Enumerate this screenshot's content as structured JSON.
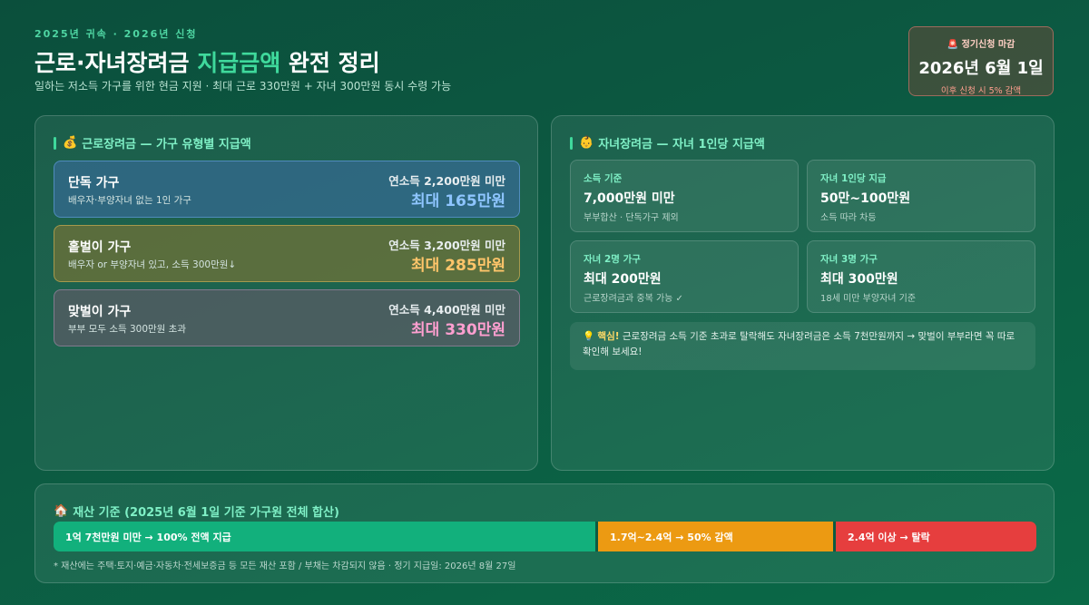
{
  "header": {
    "eyebrow": "2025년 귀속 · 2026년 신청",
    "title_pre": "근로·자녀장려금 ",
    "title_accent": "지급금액",
    "title_post": " 완전 정리",
    "subtitle": "일하는 저소득 가구를 위한 현금 지원 · 최대 근로 330만원 + 자녀 300만원 동시 수령 가능"
  },
  "deadline": {
    "label": "정기신청 마감",
    "icon": "siren-icon",
    "date": "2026년 6월 1일",
    "note": "이후 신청 시 5% 감액"
  },
  "earned_credit": {
    "heading": "근로장려금 — 가구 유형별 지급액",
    "icon": "money-bag-icon",
    "households": [
      {
        "name": "단독 가구",
        "desc": "배우자·부양자녀 없는 1인 가구",
        "limit": "연소득 2,200만원 미만",
        "amount": "최대 165만원",
        "color": "#8ec5ff"
      },
      {
        "name": "홑벌이 가구",
        "desc": "배우자 or 부양자녀 있고, 소득 300만원↓",
        "limit": "연소득 3,200만원 미만",
        "amount": "최대 285만원",
        "color": "#ffc56a"
      },
      {
        "name": "맞벌이 가구",
        "desc": "부부 모두 소득 300만원 초과",
        "limit": "연소득 4,400만원 미만",
        "amount": "최대 330만원",
        "color": "#ff9fd0"
      }
    ]
  },
  "child_credit": {
    "heading": "자녀장려금 — 자녀 1인당 지급액",
    "icon": "baby-icon",
    "cards": [
      {
        "label": "소득 기준",
        "value": "7,000만원 미만",
        "note": "부부합산 · 단독가구 제외"
      },
      {
        "label": "자녀 1인당 지급",
        "value": "50만~100만원",
        "note": "소득 따라 차등"
      },
      {
        "label": "자녀 2명 가구",
        "value": "최대 200만원",
        "note": "근로장려금과 중복 가능 ✓"
      },
      {
        "label": "자녀 3명 가구",
        "value": "최대 300만원",
        "note": "18세 미만 부양자녀 기준"
      }
    ],
    "tip_icon": "lightbulb-icon",
    "tip_key": "핵심!",
    "tip_text": " 근로장려금 소득 기준 초과로 탈락해도 자녀장려금은 소득 7천만원까지 → 맞벌이 부부라면 꼭 따로 확인해 보세요!"
  },
  "assets": {
    "heading": "재산 기준 (2025년 6월 1일 기준 가구원 전체 합산)",
    "icon": "house-icon",
    "segments": [
      {
        "label": "1억 7천만원 미만 → 100% 전액 지급",
        "color": "#12b07c"
      },
      {
        "label": "1.7억~2.4억 → 50% 감액",
        "color": "#ec9a12"
      },
      {
        "label": "2.4억 이상 → 탈락",
        "color": "#e63e3e"
      }
    ],
    "footnote": "* 재산에는 주택·토지·예금·자동차·전세보증금 등 모든 재산 포함 / 부채는 차감되지 않음 · 정기 지급일: 2026년 8월 27일"
  }
}
